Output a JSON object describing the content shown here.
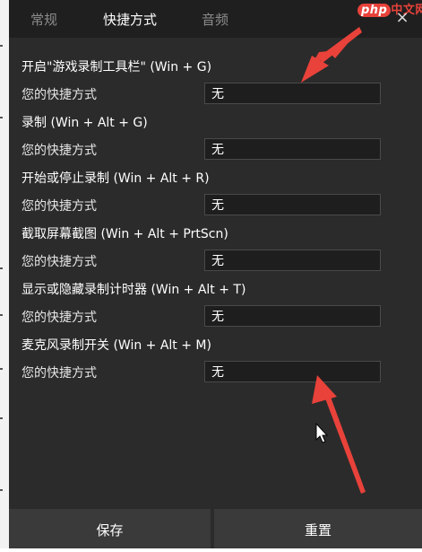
{
  "tabs": [
    {
      "label": "常规",
      "active": false
    },
    {
      "label": "快捷方式",
      "active": true
    },
    {
      "label": "音频",
      "active": false
    }
  ],
  "close_label": "×",
  "watermark": {
    "php": "php",
    "cn": "中文网"
  },
  "shortcuts": [
    {
      "title": "开启\"游戏录制工具栏\" (Win + G)",
      "sub_label": "您的快捷方式",
      "value": "无"
    },
    {
      "title": "录制 (Win + Alt + G)",
      "sub_label": "您的快捷方式",
      "value": "无"
    },
    {
      "title": "开始或停止录制 (Win + Alt + R)",
      "sub_label": "您的快捷方式",
      "value": "无"
    },
    {
      "title": "截取屏幕截图 (Win + Alt + PrtScn)",
      "sub_label": "您的快捷方式",
      "value": "无"
    },
    {
      "title": "显示或隐藏录制计时器 (Win + Alt + T)",
      "sub_label": "您的快捷方式",
      "value": "无"
    },
    {
      "title": "麦克风录制开关 (Win + Alt + M)",
      "sub_label": "您的快捷方式",
      "value": "无"
    }
  ],
  "footer": {
    "save_label": "保存",
    "reset_label": "重置"
  },
  "colors": {
    "dialog_bg": "#2b2b2b",
    "tab_bg": "#1f1f1f",
    "arrow": "#e8423a"
  }
}
